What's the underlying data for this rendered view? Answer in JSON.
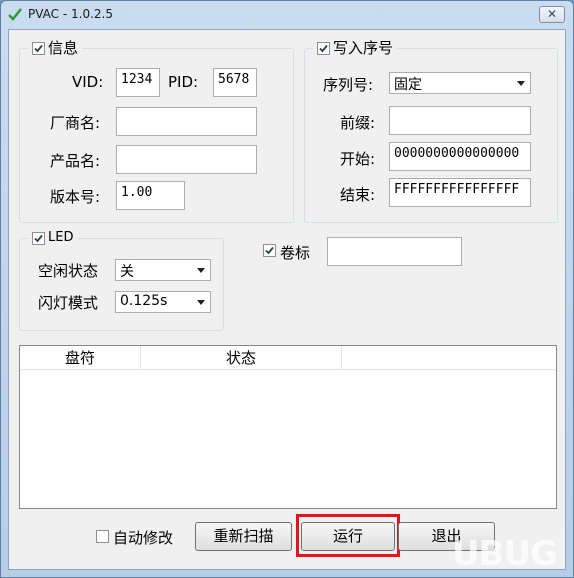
{
  "window": {
    "title": "PVAC - 1.0.2.5",
    "close_symbol": "✕"
  },
  "info": {
    "legend": "信息",
    "vid_label": "VID:",
    "vid_value": "1234",
    "pid_label": "PID:",
    "pid_value": "5678",
    "vendor_label": "厂商名:",
    "vendor_value": "",
    "product_label": "产品名:",
    "product_value": "",
    "version_label": "版本号:",
    "version_value": "1.00"
  },
  "serial": {
    "legend": "写入序号",
    "type_label": "序列号:",
    "type_value": "固定",
    "prefix_label": "前缀:",
    "prefix_value": "",
    "start_label": "开始:",
    "start_value": "0000000000000000",
    "end_label": "结束:",
    "end_value": "FFFFFFFFFFFFFFFF"
  },
  "led": {
    "legend": "LED",
    "idle_label": "空闲状态",
    "idle_value": "关",
    "blink_label": "闪灯模式",
    "blink_value": "0.125s"
  },
  "volume": {
    "label": "卷标",
    "value": ""
  },
  "table": {
    "columns": [
      "盘符",
      "状态"
    ]
  },
  "footer": {
    "auto_fix_label": "自动修改",
    "rescan_label": "重新扫描",
    "run_label": "运行",
    "exit_label": "退出"
  },
  "watermark": "UBUG"
}
